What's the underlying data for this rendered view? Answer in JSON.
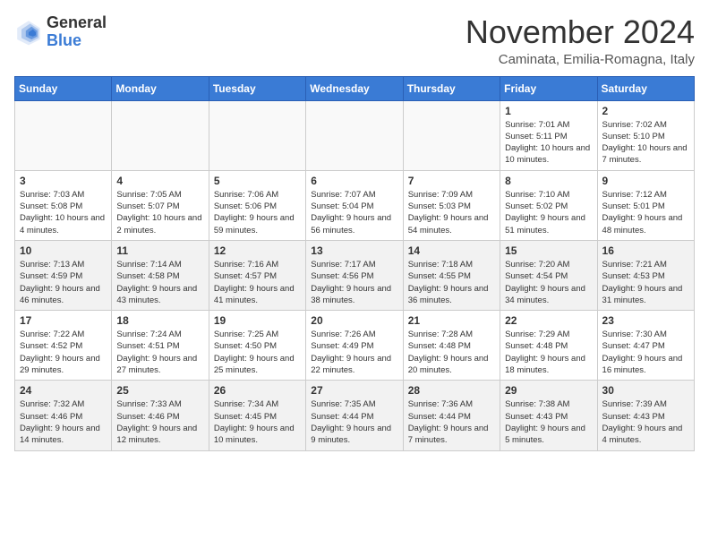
{
  "header": {
    "logo_general": "General",
    "logo_blue": "Blue",
    "month": "November 2024",
    "location": "Caminata, Emilia-Romagna, Italy"
  },
  "days_of_week": [
    "Sunday",
    "Monday",
    "Tuesday",
    "Wednesday",
    "Thursday",
    "Friday",
    "Saturday"
  ],
  "weeks": [
    {
      "shaded": false,
      "days": [
        {
          "num": "",
          "info": ""
        },
        {
          "num": "",
          "info": ""
        },
        {
          "num": "",
          "info": ""
        },
        {
          "num": "",
          "info": ""
        },
        {
          "num": "",
          "info": ""
        },
        {
          "num": "1",
          "info": "Sunrise: 7:01 AM\nSunset: 5:11 PM\nDaylight: 10 hours and 10 minutes."
        },
        {
          "num": "2",
          "info": "Sunrise: 7:02 AM\nSunset: 5:10 PM\nDaylight: 10 hours and 7 minutes."
        }
      ]
    },
    {
      "shaded": false,
      "days": [
        {
          "num": "3",
          "info": "Sunrise: 7:03 AM\nSunset: 5:08 PM\nDaylight: 10 hours and 4 minutes."
        },
        {
          "num": "4",
          "info": "Sunrise: 7:05 AM\nSunset: 5:07 PM\nDaylight: 10 hours and 2 minutes."
        },
        {
          "num": "5",
          "info": "Sunrise: 7:06 AM\nSunset: 5:06 PM\nDaylight: 9 hours and 59 minutes."
        },
        {
          "num": "6",
          "info": "Sunrise: 7:07 AM\nSunset: 5:04 PM\nDaylight: 9 hours and 56 minutes."
        },
        {
          "num": "7",
          "info": "Sunrise: 7:09 AM\nSunset: 5:03 PM\nDaylight: 9 hours and 54 minutes."
        },
        {
          "num": "8",
          "info": "Sunrise: 7:10 AM\nSunset: 5:02 PM\nDaylight: 9 hours and 51 minutes."
        },
        {
          "num": "9",
          "info": "Sunrise: 7:12 AM\nSunset: 5:01 PM\nDaylight: 9 hours and 48 minutes."
        }
      ]
    },
    {
      "shaded": true,
      "days": [
        {
          "num": "10",
          "info": "Sunrise: 7:13 AM\nSunset: 4:59 PM\nDaylight: 9 hours and 46 minutes."
        },
        {
          "num": "11",
          "info": "Sunrise: 7:14 AM\nSunset: 4:58 PM\nDaylight: 9 hours and 43 minutes."
        },
        {
          "num": "12",
          "info": "Sunrise: 7:16 AM\nSunset: 4:57 PM\nDaylight: 9 hours and 41 minutes."
        },
        {
          "num": "13",
          "info": "Sunrise: 7:17 AM\nSunset: 4:56 PM\nDaylight: 9 hours and 38 minutes."
        },
        {
          "num": "14",
          "info": "Sunrise: 7:18 AM\nSunset: 4:55 PM\nDaylight: 9 hours and 36 minutes."
        },
        {
          "num": "15",
          "info": "Sunrise: 7:20 AM\nSunset: 4:54 PM\nDaylight: 9 hours and 34 minutes."
        },
        {
          "num": "16",
          "info": "Sunrise: 7:21 AM\nSunset: 4:53 PM\nDaylight: 9 hours and 31 minutes."
        }
      ]
    },
    {
      "shaded": false,
      "days": [
        {
          "num": "17",
          "info": "Sunrise: 7:22 AM\nSunset: 4:52 PM\nDaylight: 9 hours and 29 minutes."
        },
        {
          "num": "18",
          "info": "Sunrise: 7:24 AM\nSunset: 4:51 PM\nDaylight: 9 hours and 27 minutes."
        },
        {
          "num": "19",
          "info": "Sunrise: 7:25 AM\nSunset: 4:50 PM\nDaylight: 9 hours and 25 minutes."
        },
        {
          "num": "20",
          "info": "Sunrise: 7:26 AM\nSunset: 4:49 PM\nDaylight: 9 hours and 22 minutes."
        },
        {
          "num": "21",
          "info": "Sunrise: 7:28 AM\nSunset: 4:48 PM\nDaylight: 9 hours and 20 minutes."
        },
        {
          "num": "22",
          "info": "Sunrise: 7:29 AM\nSunset: 4:48 PM\nDaylight: 9 hours and 18 minutes."
        },
        {
          "num": "23",
          "info": "Sunrise: 7:30 AM\nSunset: 4:47 PM\nDaylight: 9 hours and 16 minutes."
        }
      ]
    },
    {
      "shaded": true,
      "days": [
        {
          "num": "24",
          "info": "Sunrise: 7:32 AM\nSunset: 4:46 PM\nDaylight: 9 hours and 14 minutes."
        },
        {
          "num": "25",
          "info": "Sunrise: 7:33 AM\nSunset: 4:46 PM\nDaylight: 9 hours and 12 minutes."
        },
        {
          "num": "26",
          "info": "Sunrise: 7:34 AM\nSunset: 4:45 PM\nDaylight: 9 hours and 10 minutes."
        },
        {
          "num": "27",
          "info": "Sunrise: 7:35 AM\nSunset: 4:44 PM\nDaylight: 9 hours and 9 minutes."
        },
        {
          "num": "28",
          "info": "Sunrise: 7:36 AM\nSunset: 4:44 PM\nDaylight: 9 hours and 7 minutes."
        },
        {
          "num": "29",
          "info": "Sunrise: 7:38 AM\nSunset: 4:43 PM\nDaylight: 9 hours and 5 minutes."
        },
        {
          "num": "30",
          "info": "Sunrise: 7:39 AM\nSunset: 4:43 PM\nDaylight: 9 hours and 4 minutes."
        }
      ]
    }
  ]
}
